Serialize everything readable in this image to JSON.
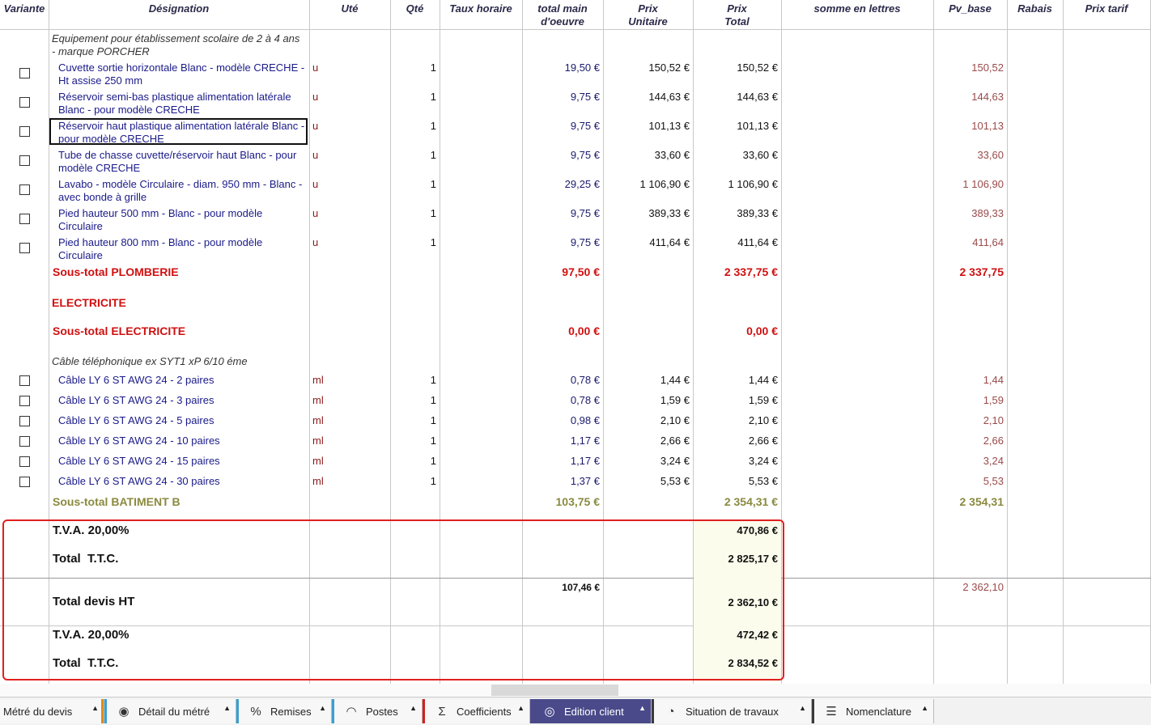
{
  "headers": {
    "variante": "Variante",
    "designation": "Désignation",
    "ute": "Uté",
    "qte": "Qté",
    "taux": "Taux horaire",
    "main": "total main\nd'oeuvre",
    "pu": "Prix\nUnitaire",
    "pt": "Prix\nTotal",
    "lettres": "somme en lettres",
    "pvbase": "Pv_base",
    "rabais": "Rabais",
    "tarif": "Prix tarif"
  },
  "group1_title": "Equipement pour établissement scolaire de 2 à 4 ans\n- marque PORCHER",
  "plumbing_items": [
    {
      "desc": "Cuvette sortie horizontale Blanc - modèle CRECHE -\nHt assise 250 mm",
      "unit": "u",
      "qty": "1",
      "mo": "19,50 €",
      "pu": "150,52 €",
      "pt": "150,52 €",
      "pv": "150,52"
    },
    {
      "desc": "Réservoir semi-bas plastique alimentation latérale\nBlanc - pour modèle CRECHE",
      "unit": "u",
      "qty": "1",
      "mo": "9,75 €",
      "pu": "144,63 €",
      "pt": "144,63 €",
      "pv": "144,63"
    },
    {
      "desc": "Réservoir haut plastique alimentation latérale Blanc -\npour modèle CRECHE",
      "unit": "u",
      "qty": "1",
      "mo": "9,75 €",
      "pu": "101,13 €",
      "pt": "101,13 €",
      "pv": "101,13"
    },
    {
      "desc": "Tube de chasse cuvette/réservoir haut Blanc - pour\nmodèle CRECHE",
      "unit": "u",
      "qty": "1",
      "mo": "9,75 €",
      "pu": "33,60 €",
      "pt": "33,60 €",
      "pv": "33,60"
    },
    {
      "desc": "Lavabo - modèle Circulaire - diam. 950 mm - Blanc -\navec bonde à grille",
      "unit": "u",
      "qty": "1",
      "mo": "29,25 €",
      "pu": "1 106,90 €",
      "pt": "1 106,90 €",
      "pv": "1 106,90"
    },
    {
      "desc": "Pied hauteur 500 mm - Blanc - pour modèle\nCirculaire",
      "unit": "u",
      "qty": "1",
      "mo": "9,75 €",
      "pu": "389,33 €",
      "pt": "389,33 €",
      "pv": "389,33"
    },
    {
      "desc": "Pied hauteur 800 mm - Blanc - pour modèle\nCirculaire",
      "unit": "u",
      "qty": "1",
      "mo": "9,75 €",
      "pu": "411,64 €",
      "pt": "411,64 €",
      "pv": "411,64"
    }
  ],
  "subtotal_plomberie": {
    "label": "Sous-total PLOMBERIE",
    "mo": "97,50 €",
    "pt": "2 337,75 €",
    "pv": "2 337,75"
  },
  "electricite_title": "ELECTRICITE",
  "subtotal_electricite": {
    "label": "Sous-total ELECTRICITE",
    "mo": "0,00 €",
    "pt": "0,00 €"
  },
  "group2_title": "Câble téléphonique ex SYT1 xP 6/10 éme",
  "cable_items": [
    {
      "desc": "Câble LY 6 ST AWG 24 - 2 paires",
      "unit": "ml",
      "qty": "1",
      "mo": "0,78 €",
      "pu": "1,44 €",
      "pt": "1,44 €",
      "pv": "1,44"
    },
    {
      "desc": "Câble LY 6 ST AWG 24 - 3 paires",
      "unit": "ml",
      "qty": "1",
      "mo": "0,78 €",
      "pu": "1,59 €",
      "pt": "1,59 €",
      "pv": "1,59"
    },
    {
      "desc": "Câble LY 6 ST AWG 24 - 5 paires",
      "unit": "ml",
      "qty": "1",
      "mo": "0,98 €",
      "pu": "2,10 €",
      "pt": "2,10 €",
      "pv": "2,10"
    },
    {
      "desc": "Câble LY 6 ST AWG 24 - 10 paires",
      "unit": "ml",
      "qty": "1",
      "mo": "1,17 €",
      "pu": "2,66 €",
      "pt": "2,66 €",
      "pv": "2,66"
    },
    {
      "desc": "Câble LY 6 ST AWG 24 - 15 paires",
      "unit": "ml",
      "qty": "1",
      "mo": "1,17 €",
      "pu": "3,24 €",
      "pt": "3,24 €",
      "pv": "3,24"
    },
    {
      "desc": "Câble LY 6 ST AWG 24 - 30 paires",
      "unit": "ml",
      "qty": "1",
      "mo": "1,37 €",
      "pu": "5,53 €",
      "pt": "5,53 €",
      "pv": "5,53"
    }
  ],
  "subtotal_batiment": {
    "label": "Sous-total BATIMENT B",
    "mo": "103,75 €",
    "pt": "2 354,31 €",
    "pv": "2 354,31"
  },
  "tva1": {
    "label": "T.V.A. 20,00%",
    "value": "470,86 €"
  },
  "ttc1": {
    "label": "Total  T.T.C.",
    "value": "2 825,17 €"
  },
  "devis": {
    "label": "Total devis HT",
    "mo": "107,46 €",
    "value": "2 362,10 €",
    "pv": "2 362,10"
  },
  "tva2": {
    "label": "T.V.A. 20,00%",
    "value": "472,42 €"
  },
  "ttc2": {
    "label": "Total  T.T.C.",
    "value": "2 834,52 €"
  },
  "tabs": [
    {
      "label": "Métré du devis",
      "icon": "",
      "color": "#e08a1a"
    },
    {
      "label": "Détail du métré",
      "icon": "◉",
      "color": "#3aa0d0"
    },
    {
      "label": "Remises",
      "icon": "%",
      "color": "#3aa0d0"
    },
    {
      "label": "Postes",
      "icon": "◠",
      "color": "#3aa0d0"
    },
    {
      "label": "Coefficients",
      "icon": "Σ",
      "color": "#d02020"
    },
    {
      "label": "Edition client",
      "icon": "◎",
      "color": "#4a4a8a"
    },
    {
      "label": "Situation de travaux",
      "icon": "◔",
      "color": "#3a3a3a"
    },
    {
      "label": "Nomenclature",
      "icon": "☰",
      "color": "#3a3a3a"
    }
  ],
  "tab_arrow": "▲",
  "active_tab": "Edition client"
}
